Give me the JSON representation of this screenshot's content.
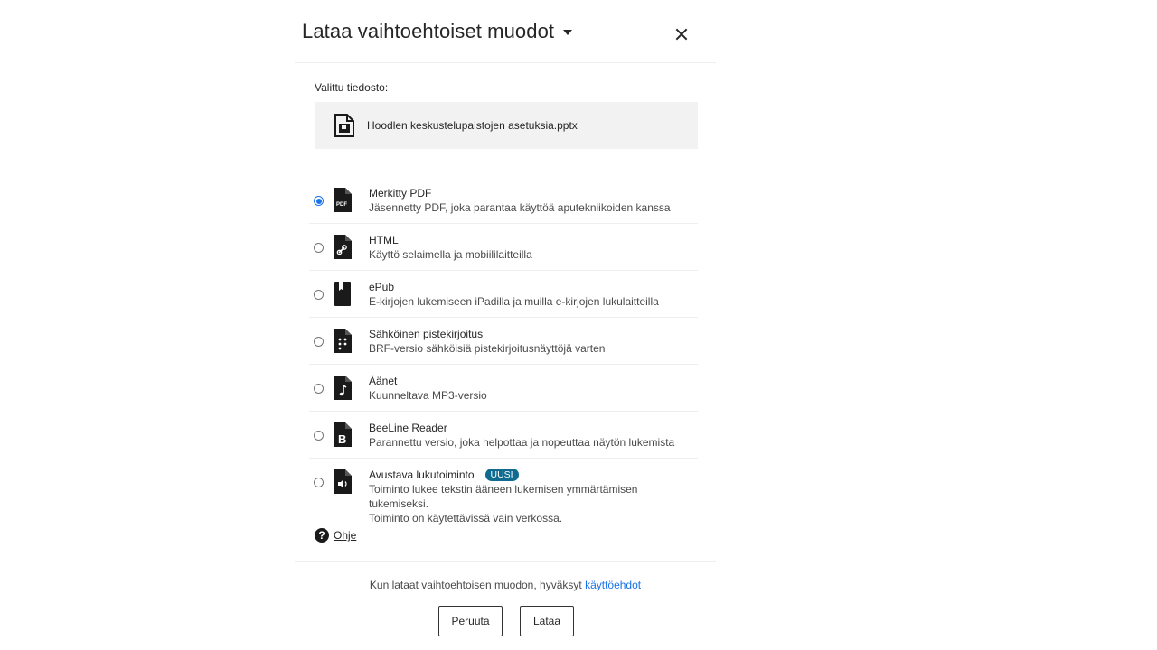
{
  "dialog": {
    "title": "Lataa vaihtoehtoiset muodot",
    "close_label": "×"
  },
  "selected": {
    "label": "Valittu tiedosto:",
    "file_name": "Hoodlen keskustelupalstojen asetuksia.pptx",
    "file_icon": "pptx-file-icon"
  },
  "options": [
    {
      "title": "Merkitty PDF",
      "desc": "Jäsennetty PDF, joka parantaa käyttöä aputekniikoiden kanssa",
      "icon": "pdf-file-icon",
      "selected": true
    },
    {
      "title": "HTML",
      "desc": "Käyttö selaimella ja mobiililaitteilla",
      "icon": "html-link-file-icon",
      "selected": false
    },
    {
      "title": "ePub",
      "desc": "E-kirjojen lukemiseen iPadilla ja muilla e-kirjojen lukulaitteilla",
      "icon": "epub-book-icon",
      "selected": false
    },
    {
      "title": "Sähköinen pistekirjoitus",
      "desc": "BRF-versio sähköisiä pistekirjoitusnäyttöjä varten",
      "icon": "braille-file-icon",
      "selected": false
    },
    {
      "title": "Äänet",
      "desc": "Kuunneltava MP3-versio",
      "icon": "audio-file-icon",
      "selected": false
    },
    {
      "title": "BeeLine Reader",
      "desc": "Parannettu versio, joka helpottaa ja nopeuttaa näytön lukemista",
      "icon": "beeline-file-icon",
      "selected": false
    },
    {
      "title": "Avustava lukutoiminto",
      "badge": "UUSI",
      "desc": "Toiminto lukee tekstin ääneen lukemisen ymmärtämisen tukemiseksi.",
      "desc2": "Toiminto on käytettävissä vain verkossa.",
      "icon": "speaker-file-icon",
      "selected": false
    }
  ],
  "help": {
    "label": "Ohje",
    "icon_glyph": "?"
  },
  "footer": {
    "note": "Kun lataat vaihtoehtoisen muodon, hyväksyt",
    "link": "käyttöehdot"
  },
  "buttons": {
    "cancel": "Peruuta",
    "download": "Lataa"
  },
  "colors": {
    "accent": "#1a73e8",
    "badge": "#0f6b8f",
    "file_box": "#f2f2f2"
  }
}
